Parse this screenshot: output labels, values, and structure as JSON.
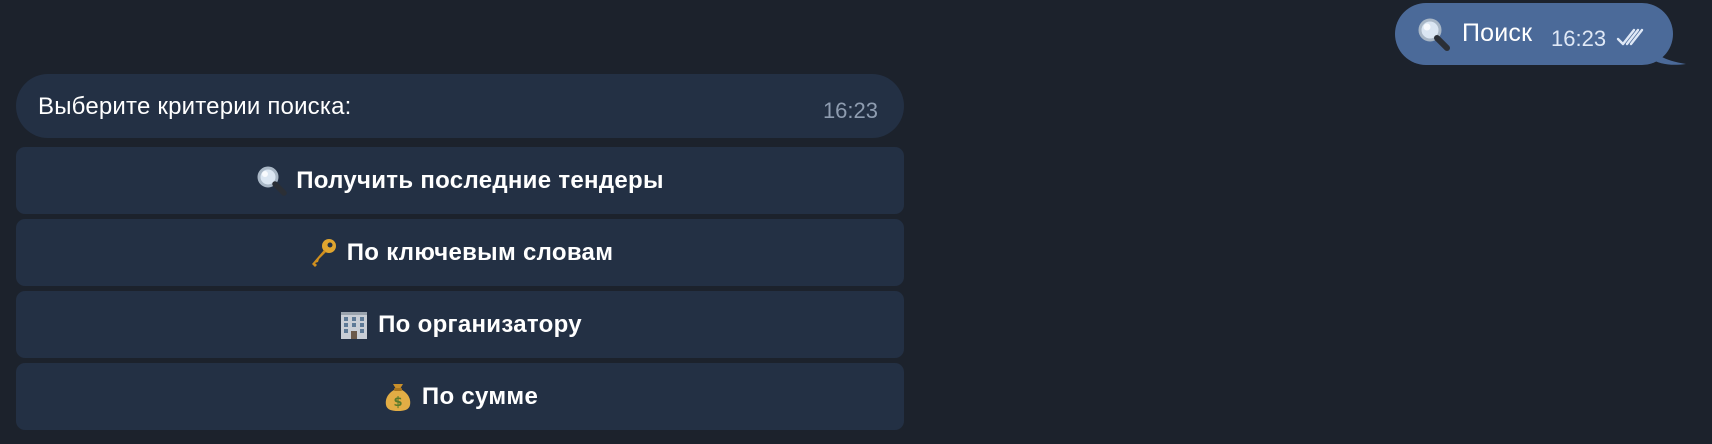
{
  "outgoing": {
    "icon": "magnifier-icon",
    "text": "Поиск",
    "time": "16:23",
    "status_icon": "double-check-icon",
    "bubble_color": "#4b6a99"
  },
  "incoming": {
    "text": "Выберите критерии поиска:",
    "time": "16:23",
    "bubble_color": "#233044"
  },
  "keyboard": [
    {
      "icon": "magnifier-icon",
      "label": "Получить последние тендеры"
    },
    {
      "icon": "key-icon",
      "label": "По ключевым словам"
    },
    {
      "icon": "office-building-icon",
      "label": "По организатору"
    },
    {
      "icon": "money-bag-icon",
      "label": "По сумме"
    }
  ],
  "colors": {
    "background": "#1c222c",
    "button": "#233044",
    "text": "#ffffff",
    "muted_time": "#8e9cb0"
  }
}
